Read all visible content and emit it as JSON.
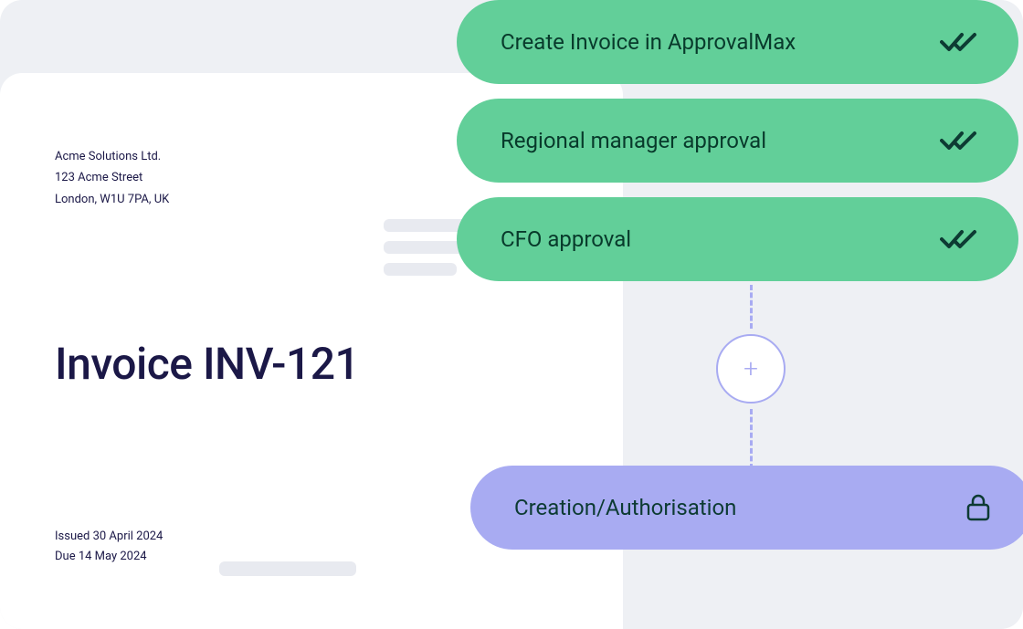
{
  "invoice": {
    "company": {
      "name": "Acme Solutions Ltd.",
      "street": "123 Acme Street",
      "city_line": "London, W1U 7PA, UK"
    },
    "title": "Invoice INV-121",
    "issued_label": "Issued 30 April 2024",
    "due_label": "Due 14 May 2024"
  },
  "workflow": {
    "steps": [
      {
        "label": "Create Invoice in ApprovalMax",
        "status": "done"
      },
      {
        "label": "Regional manager approval",
        "status": "done"
      },
      {
        "label": "CFO approval",
        "status": "done"
      }
    ],
    "final": {
      "label": "Creation/Authorisation",
      "locked": true
    }
  },
  "colors": {
    "green": "#62cf99",
    "purple": "#a8abf2",
    "text_dark": "#1b1847",
    "text_green": "#083a2b"
  }
}
